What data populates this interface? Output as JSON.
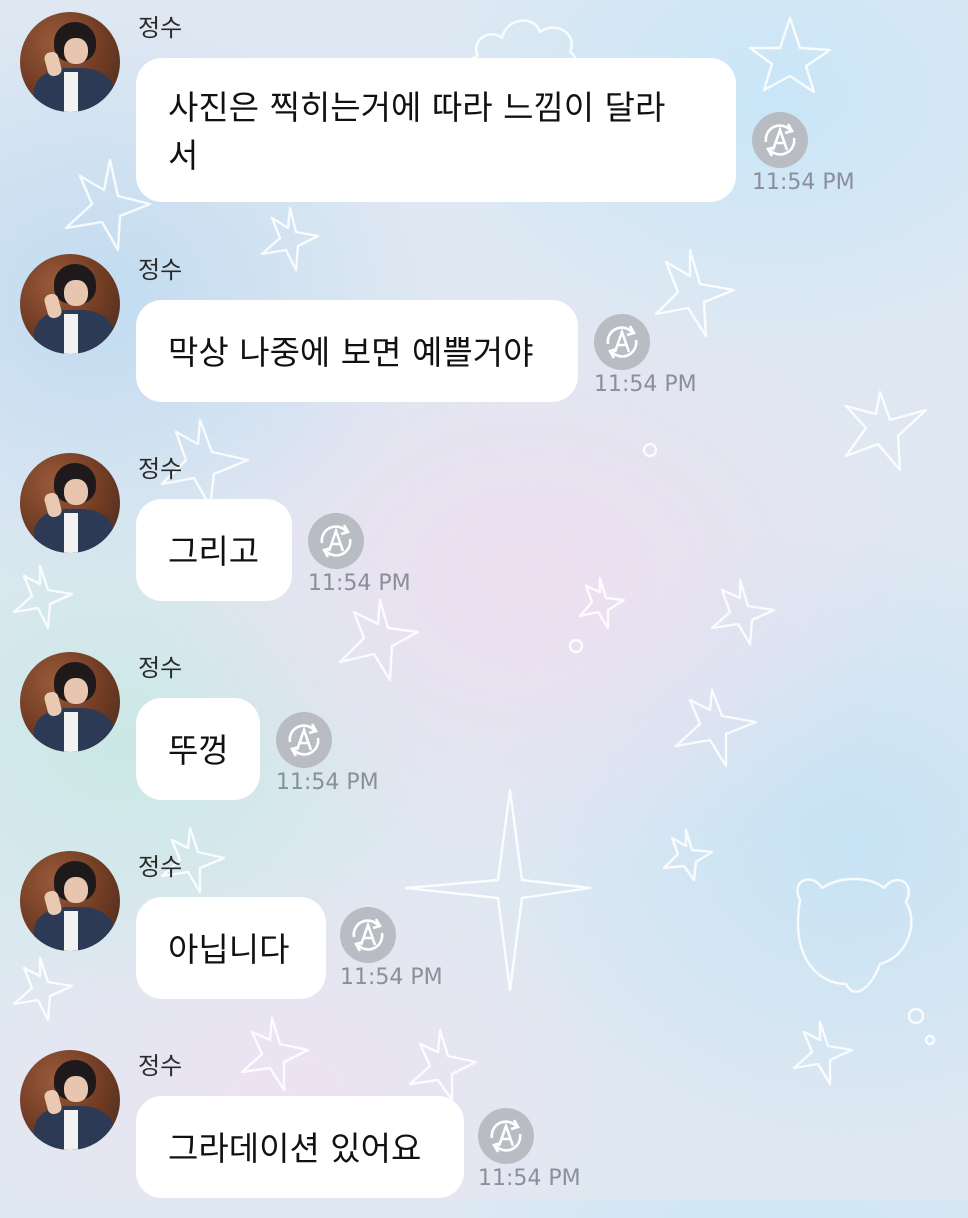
{
  "chat": {
    "messages": [
      {
        "sender": "정수",
        "text": "사진은 찍히는거에 따라 느낌이 달라\n서",
        "time": "11:54 PM"
      },
      {
        "sender": "정수",
        "text": "막상 나중에 보면 예쁠거야",
        "time": "11:54 PM"
      },
      {
        "sender": "정수",
        "text": "그리고",
        "time": "11:54 PM"
      },
      {
        "sender": "정수",
        "text": "뚜껑",
        "time": "11:54 PM"
      },
      {
        "sender": "정수",
        "text": "아닙니다",
        "time": "11:54 PM"
      },
      {
        "sender": "정수",
        "text": "그라데이션 있어요",
        "time": "11:54 PM"
      }
    ]
  },
  "icons": {
    "avatar": "profile-photo",
    "translate": "translate-icon"
  },
  "colors": {
    "bubble": "#ffffff",
    "time": "#8a8f99",
    "translate_icon": "#b9bcc2"
  }
}
